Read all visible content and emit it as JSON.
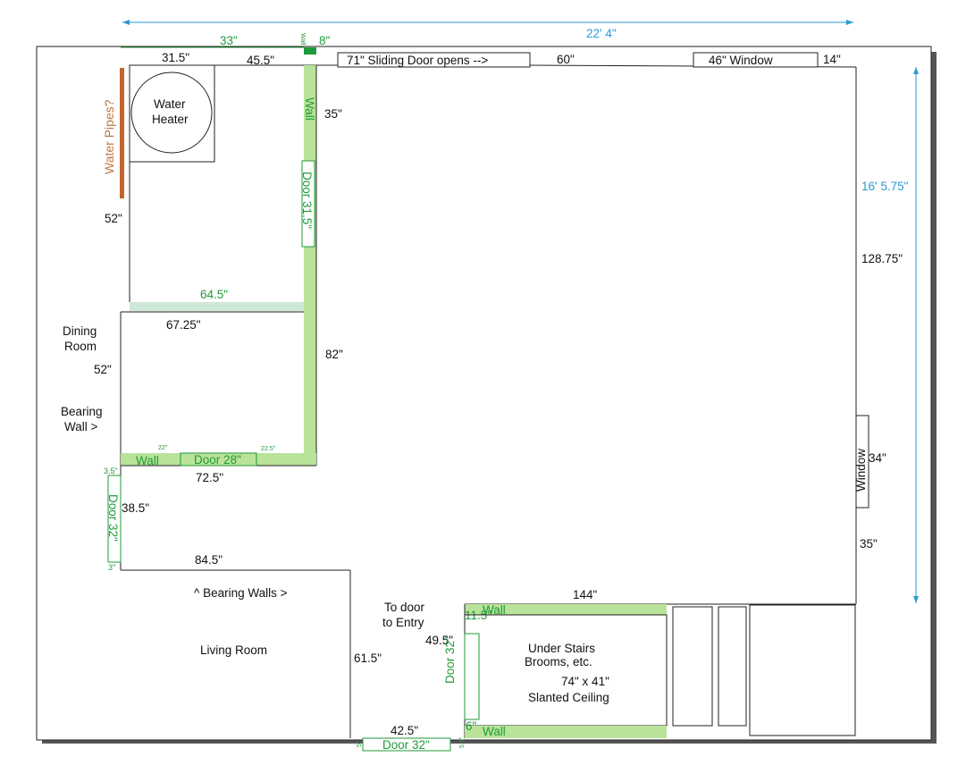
{
  "colors": {
    "wall_fill": "#b9e39a",
    "wall_label": "#1f9a3a",
    "light_wall": "#cfe8d8",
    "dimension_blue": "#2a9ad6",
    "pipes": "#c0652b",
    "shadow": "#555555"
  },
  "dimensions": {
    "overall_width": "22' 4\"",
    "overall_height": "16' 5.75\""
  },
  "labels": {
    "d_33": "33\"",
    "d_8": "8\"",
    "wall_tiny": "Wall",
    "d_31_5": "31.5\"",
    "d_45_5": "45.5\"",
    "sliding_door": "71\"  Sliding Door opens -->",
    "d_60": "60\"",
    "window_top": "46\"  Window",
    "d_14": "14\"",
    "water_heater_1": "Water",
    "water_heater_2": "Heater",
    "water_pipes": "Water Pipes?",
    "wall_vertical": "Wall",
    "d_35_top": "35\"",
    "door_31_5": "Door 31.5\"",
    "d_52_top": "52\"",
    "d_128_75": "128.75\"",
    "d_64_5": "64.5\"",
    "d_67_25": "67.25\"",
    "dining_room_1": "Dining",
    "dining_room_2": "Room",
    "d_52_mid": "52\"",
    "d_82": "82\"",
    "bearing_wall_1": "Bearing",
    "bearing_wall_2": "Wall  >",
    "d_22": "22\"",
    "wall_horizontal": "Wall",
    "door_28": "Door 28\"",
    "d_22_5": "22.5\"",
    "d_72_5": "72.5\"",
    "window_right": "Window",
    "d_34": "34\"",
    "d_3_5": "3.5\"",
    "door_32_left": "Door 32\"",
    "d_38_5": "38.5\"",
    "d_3": "3\"",
    "d_35_right": "35\"",
    "d_84_5": "84.5\"",
    "bearing_walls": "^ Bearing Walls  >",
    "to_door_1": "To door",
    "to_door_2": "to Entry",
    "d_144": "144\"",
    "wall_stairs_top": "Wall",
    "d_11_5": "11.5\"",
    "living_room": "Living Room",
    "d_49_5": "49.5\"",
    "under_stairs_1": "Under Stairs",
    "under_stairs_2": "Brooms, etc.",
    "d_61_5": "61.5\"",
    "door_32_stairs": "Door 32\"",
    "stairs_size": "74\" x 41\"",
    "slanted_ceiling": "Slanted Ceiling",
    "d_6": "6\"",
    "wall_stairs_bottom": "Wall",
    "d_42_5": "42.5\"",
    "door_32_bottom": "Door 32\"",
    "d_5_left": "5\"",
    "d_5_right": "5.5\""
  }
}
